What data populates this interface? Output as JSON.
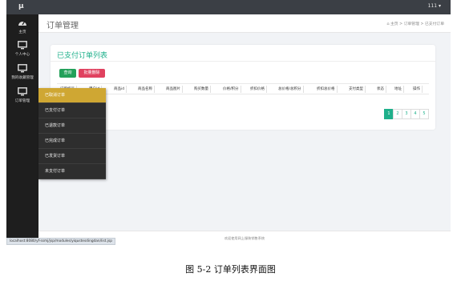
{
  "app": {
    "logo_text": "μ",
    "user_menu": "111 ▾"
  },
  "sidebar": {
    "items": [
      {
        "label": "主页",
        "icon": "dashboard-icon"
      },
      {
        "label": "个人中心",
        "icon": "monitor-icon"
      },
      {
        "label": "我的收藏管理",
        "icon": "monitor-icon"
      },
      {
        "label": "订单管理",
        "icon": "monitor-icon"
      }
    ]
  },
  "header": {
    "page_title": "订单管理",
    "breadcrumb": {
      "home_icon": "home-icon",
      "home": "主页",
      "sep1": ">",
      "section": "订单管理",
      "sep2": ">",
      "current": "已支付订单"
    }
  },
  "card": {
    "title": "已支付订单列表",
    "search_button": "查询",
    "batch_delete_button": "批量删除",
    "columns": [
      "订单编号",
      "用户id",
      "商品id",
      "商品名称",
      "商品图片",
      "购买数量",
      "价格/积分",
      "折扣价格",
      "总价格/总积分",
      "折扣总价格",
      "支付类型",
      "状态",
      "地址",
      "操作"
    ]
  },
  "pagination": {
    "pages": [
      "1",
      "2",
      "3",
      "4",
      "5"
    ],
    "active": "1"
  },
  "submenu": {
    "items": [
      "已取消订单",
      "已支付订单",
      "已退款订单",
      "已完成订单",
      "已发货订单",
      "未支付订单"
    ],
    "active_index": 0
  },
  "footer": {
    "text": "欢迎使用网上服装销售系统"
  },
  "status_bar": {
    "url": "localhost:8080/yf-ssmj/jsp/modules/yiqustesdingdan/list.jsp"
  },
  "caption": "图 5-2 订单列表界面图",
  "colors": {
    "accent": "#1fb08b",
    "topbar": "#3b3f45",
    "sidebar": "#1e1e1e",
    "submenu_active": "#cfa733",
    "search_btn": "#23a05a",
    "delete_btn": "#e0415f"
  }
}
